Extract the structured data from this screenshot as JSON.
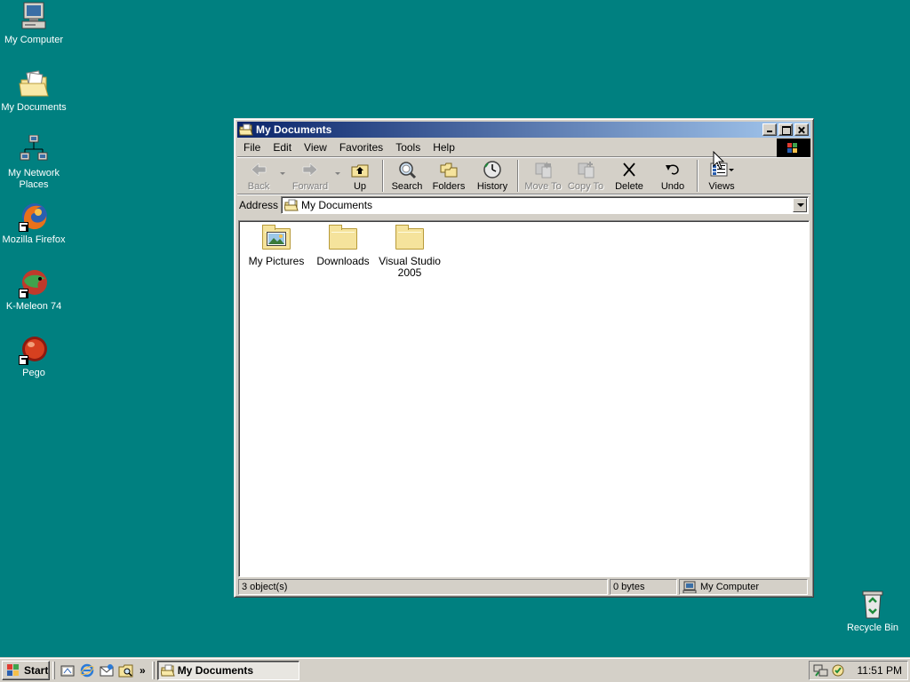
{
  "desktop": {
    "icons": [
      {
        "label": "My Computer"
      },
      {
        "label": "My Documents"
      },
      {
        "label": "My Network Places"
      },
      {
        "label": "Mozilla Firefox"
      },
      {
        "label": "K-Meleon 74"
      },
      {
        "label": "Pego"
      },
      {
        "label": "Recycle Bin"
      }
    ],
    "background_color": "#008080"
  },
  "window": {
    "title": "My Documents",
    "menu": [
      "File",
      "Edit",
      "View",
      "Favorites",
      "Tools",
      "Help"
    ],
    "toolbar": {
      "back": "Back",
      "forward": "Forward",
      "up": "Up",
      "search": "Search",
      "folders": "Folders",
      "history": "History",
      "move_to": "Move To",
      "copy_to": "Copy To",
      "delete": "Delete",
      "undo": "Undo",
      "views": "Views"
    },
    "address": {
      "label": "Address",
      "value": "My Documents"
    },
    "items": [
      {
        "label": "My Pictures",
        "icon": "pictures-folder-icon"
      },
      {
        "label": "Downloads",
        "icon": "folder-icon"
      },
      {
        "label": "Visual Studio 2005",
        "icon": "folder-icon"
      }
    ],
    "status": {
      "objects": "3 object(s)",
      "size": "0 bytes",
      "zone": "My Computer"
    }
  },
  "taskbar": {
    "start_label": "Start",
    "task_label": "My Documents",
    "chevron": "»",
    "clock": "11:51 PM"
  }
}
